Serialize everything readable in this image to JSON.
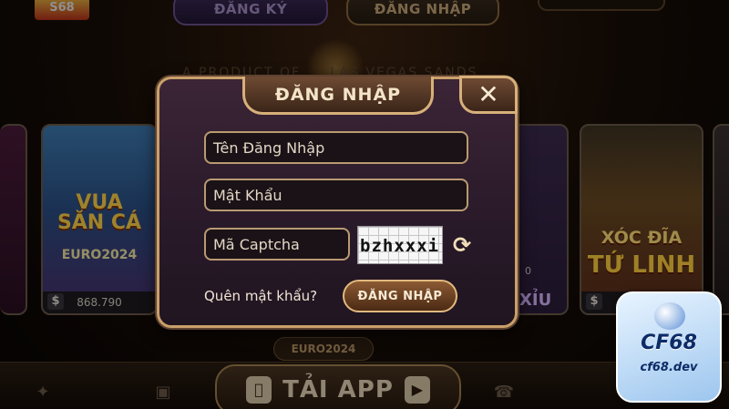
{
  "topbar": {
    "register_label": "ĐĂNG KÝ",
    "login_label": "ĐĂNG NHẬP"
  },
  "banner": {
    "text": "A PRODUCT OF ... LAS VEGAS SANDS"
  },
  "cards": {
    "vua": {
      "title_line1": "VUA",
      "title_line2": "SĂN CÁ",
      "subtitle": "EURO2024",
      "amount": "868.790"
    },
    "xiu": {
      "amount": "0",
      "label": "XỈU"
    },
    "xoc": {
      "title_line1": "XÓC ĐĨA",
      "title_line2": "TỨ LINH"
    }
  },
  "dialog": {
    "title": "ĐĂNG NHẬP",
    "close_symbol": "✕",
    "username_placeholder": "Tên Đăng Nhập",
    "password_placeholder": "Mật Khẩu",
    "captcha_placeholder": "Mã Captcha",
    "captcha_code": "bzhxxxi",
    "forgot_label": "Quên mật khẩu?",
    "submit_label": "ĐĂNG NHẬP"
  },
  "bottombar": {
    "badge": "EURO2024",
    "download_label": "TẢI APP"
  },
  "watermark": {
    "brand": "CF68",
    "domain": "cf68.dev"
  },
  "colors": {
    "gold_border": "#c9a06a",
    "dialog_bg": "#2a1a2a",
    "button_bg": "#8b5a33"
  }
}
